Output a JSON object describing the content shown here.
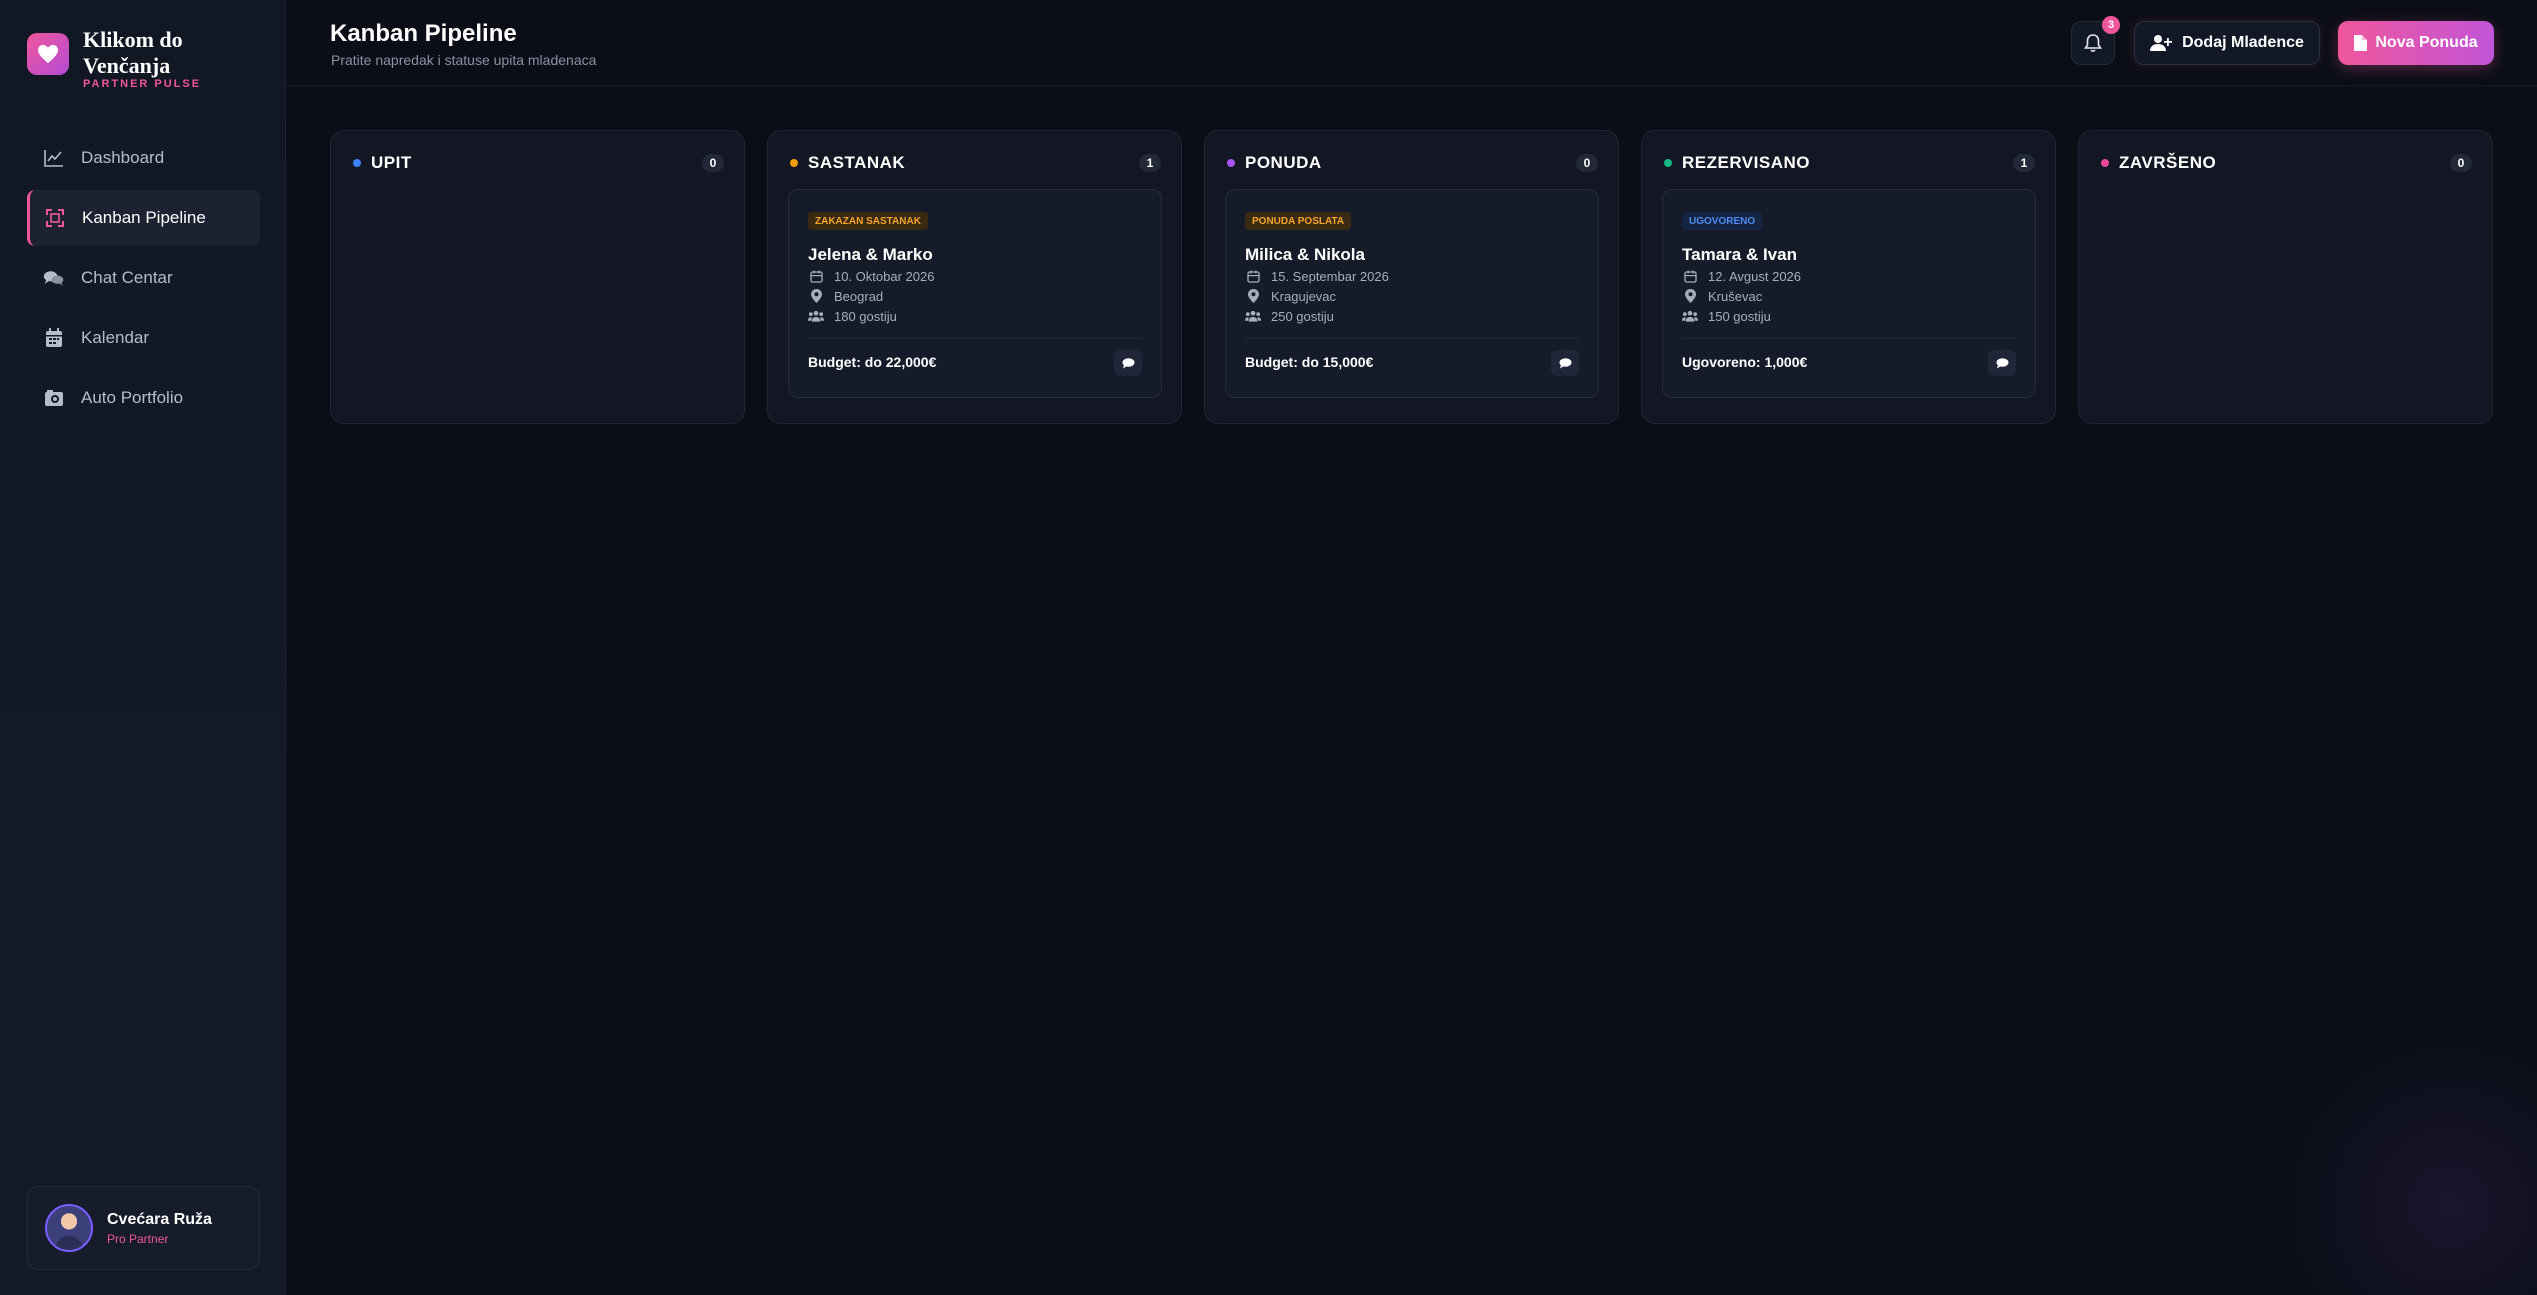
{
  "brand": {
    "title": "Klikom do Venčanja",
    "subtitle": "PARTNER PULSE",
    "accent": "#f0569b"
  },
  "nav": {
    "items": [
      {
        "label": "Dashboard",
        "icon": "line-chart-icon",
        "active": false
      },
      {
        "label": "Kanban Pipeline",
        "icon": "kanban-icon",
        "active": true
      },
      {
        "label": "Chat Centar",
        "icon": "chat-icon",
        "active": false
      },
      {
        "label": "Kalendar",
        "icon": "calendar-icon",
        "active": false
      },
      {
        "label": "Auto Portfolio",
        "icon": "camera-icon",
        "active": false
      }
    ]
  },
  "user": {
    "name": "Cvećara Ruža",
    "role": "Pro Partner"
  },
  "header": {
    "title": "Kanban Pipeline",
    "subtitle": "Pratite napredak i statuse upita mladenaca",
    "notifications": "3",
    "add_button": "Dodaj Mladence",
    "new_button": "Nova Ponuda"
  },
  "columns": [
    {
      "title": "UPIT",
      "count": "0",
      "color": "#3b82f6",
      "cards": []
    },
    {
      "title": "SASTANAK",
      "count": "1",
      "color": "#f59e0b",
      "cards": [
        {
          "tag": "ZAKAZAN SASTANAK",
          "couple": "Jelena & Marko",
          "date": "10. Oktobar 2026",
          "city": "Beograd",
          "guests": "180 gostiju",
          "budget": "Budget: do 22,000€"
        }
      ]
    },
    {
      "title": "PONUDA",
      "count": "0",
      "color": "#a855f7",
      "cards": [
        {
          "tag": "PONUDA POSLATA",
          "couple": "Milica & Nikola",
          "date": "15. Septembar 2026",
          "city": "Kragujevac",
          "guests": "250 gostiju",
          "budget": "Budget: do 15,000€"
        }
      ]
    },
    {
      "title": "REZERVISANO",
      "count": "1",
      "color": "#10b981",
      "cards": [
        {
          "tag": "UGOVORENO",
          "couple": "Tamara & Ivan",
          "date": "12. Avgust 2026",
          "city": "Kruševac",
          "guests": "150 gostiju",
          "budget": "Ugovoreno: 1,000€"
        }
      ]
    },
    {
      "title": "ZAVRŠENO",
      "count": "0",
      "color": "#ec4899",
      "cards": []
    }
  ]
}
